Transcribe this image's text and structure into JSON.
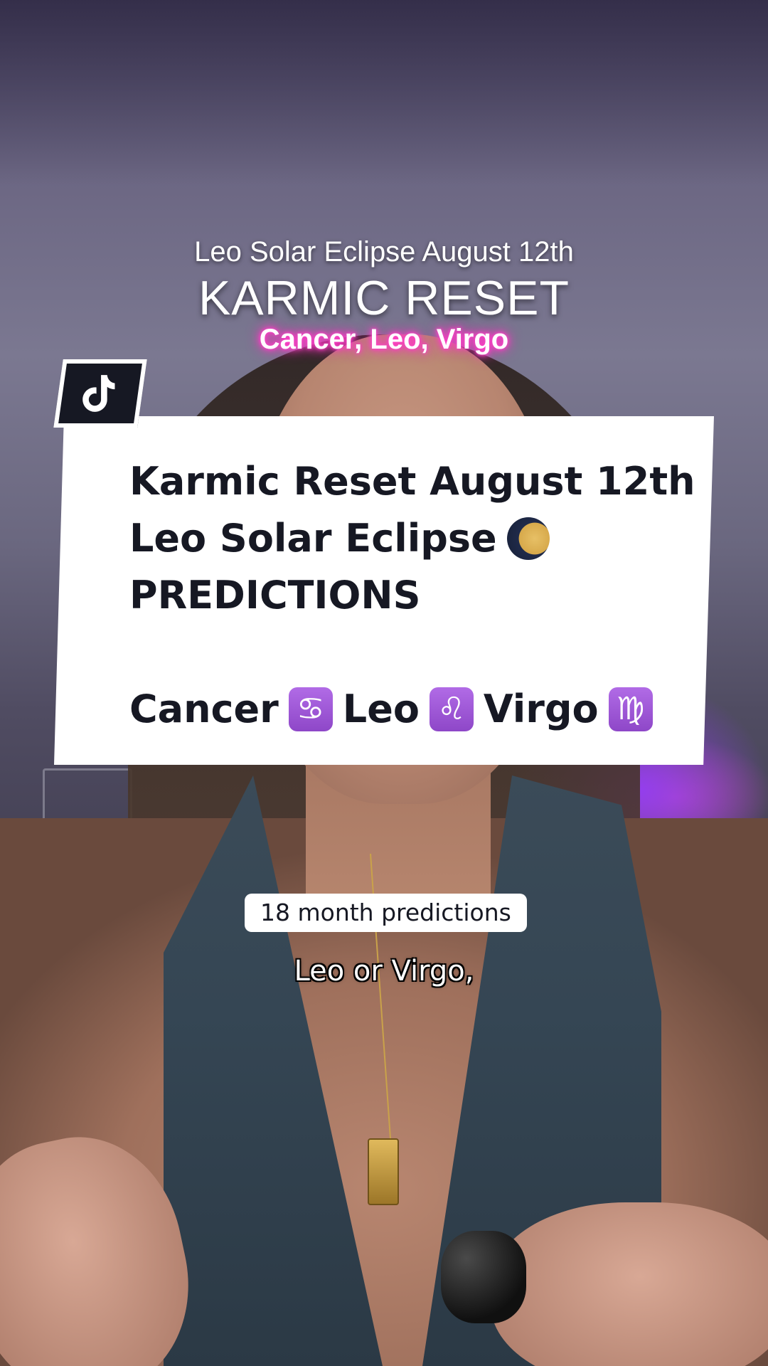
{
  "overlay": {
    "subtitle": "Leo Solar Eclipse August 12th",
    "title": "KARMIC RESET",
    "signs": "Cancer, Leo, Virgo"
  },
  "badge": {
    "icon": "tiktok-logo-icon"
  },
  "card": {
    "line1": "Karmic Reset August 12th",
    "line2_text": "Leo Solar Eclipse",
    "line2_icon": "first-quarter-moon-icon",
    "line3": "PREDICTIONS",
    "signs": [
      {
        "name": "Cancer",
        "symbol": "♋",
        "icon": "cancer-zodiac-icon"
      },
      {
        "name": "Leo",
        "symbol": "♌",
        "icon": "leo-zodiac-icon"
      },
      {
        "name": "Virgo",
        "symbol": "♍",
        "icon": "virgo-zodiac-icon"
      }
    ]
  },
  "captions": {
    "pill": "18 month predictions",
    "speech": "Leo or Virgo,"
  },
  "colors": {
    "card_bg": "#ffffff",
    "card_text": "#161823",
    "signs_glow": "#ff3fc8",
    "zodiac_bg": "#9b55d6"
  }
}
